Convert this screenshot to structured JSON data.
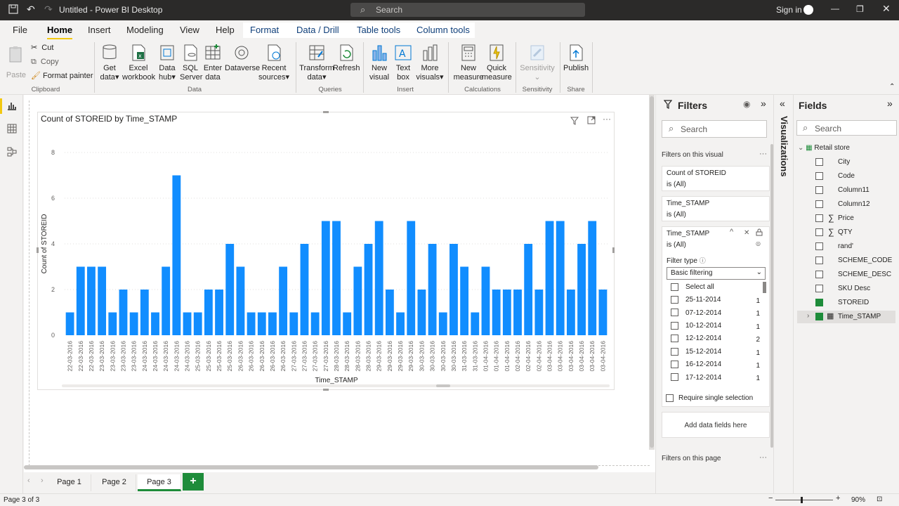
{
  "titlebar": {
    "title": "Untitled - Power BI Desktop",
    "search": "Search",
    "signin": "Sign in"
  },
  "menu": {
    "file": "File",
    "home": "Home",
    "insert": "Insert",
    "modeling": "Modeling",
    "view": "View",
    "help": "Help",
    "format": "Format",
    "data_drill": "Data / Drill",
    "table_tools": "Table tools",
    "column_tools": "Column tools"
  },
  "ribbon": {
    "paste": "Paste",
    "cut": "Cut",
    "copy": "Copy",
    "format_painter": "Format painter",
    "clipboard": "Clipboard",
    "get_data": [
      "Get",
      "data"
    ],
    "excel": [
      "Excel",
      "workbook"
    ],
    "datahub": [
      "Data",
      "hub"
    ],
    "sql": [
      "SQL",
      "Server"
    ],
    "enter": [
      "Enter",
      "data"
    ],
    "dataverse": "Dataverse",
    "recent": [
      "Recent",
      "sources"
    ],
    "data_group": "Data",
    "transform": [
      "Transform",
      "data"
    ],
    "refresh": "Refresh",
    "queries": "Queries",
    "new_visual": [
      "New",
      "visual"
    ],
    "text_box": [
      "Text",
      "box"
    ],
    "more_visuals": [
      "More",
      "visuals"
    ],
    "insert": "Insert",
    "new_measure": [
      "New",
      "measure"
    ],
    "quick_measure": [
      "Quick",
      "measure"
    ],
    "calculations": "Calculations",
    "sensitivity_btn": "Sensitivity",
    "sensitivity": "Sensitivity",
    "publish": "Publish",
    "share": "Share"
  },
  "visual": {
    "title": "Count of STOREID by Time_STAMP"
  },
  "chart_data": {
    "type": "bar",
    "title": "Count of STOREID by Time_STAMP",
    "xlabel": "Time_STAMP",
    "ylabel": "Count of STOREID",
    "ylim": [
      0,
      8
    ],
    "yticks": [
      0,
      2,
      4,
      6,
      8
    ],
    "color": "#118dff",
    "categories": [
      "22-03-2016",
      "22-03-2016",
      "22-03-2016",
      "23-03-2016",
      "23-03-2016",
      "23-03-2016",
      "23-03-2016",
      "24-03-2016",
      "24-03-2016",
      "24-03-2016",
      "24-03-2016",
      "24-03-2016",
      "25-03-2016",
      "25-03-2016",
      "25-03-2016",
      "25-03-2016",
      "26-03-2016",
      "26-03-2016",
      "26-03-2016",
      "26-03-2016",
      "26-03-2016",
      "27-03-2016",
      "27-03-2016",
      "27-03-2016",
      "27-03-2016",
      "28-03-2016",
      "28-03-2016",
      "28-03-2016",
      "28-03-2016",
      "29-03-2016",
      "29-03-2016",
      "29-03-2016",
      "29-03-2016",
      "30-03-2016",
      "30-03-2016",
      "30-03-2016",
      "30-03-2016",
      "31-03-2016",
      "31-03-2016",
      "01-04-2016",
      "01-04-2016",
      "01-04-2016",
      "02-04-2016",
      "02-04-2016",
      "02-04-2016",
      "03-04-2016",
      "03-04-2016",
      "03-04-2016",
      "03-04-2016",
      "03-04-2016",
      "03-04-2016",
      "03-04-2016",
      "03-04-2016",
      "03-04-2016",
      "03-04-2016",
      "03-04-2016",
      "03-04-2016",
      "03-04-2016",
      "03-04-2016",
      "03-04-2016",
      "03-04-2016",
      "03-04-2016",
      "03-04-2016",
      "03-04-2016",
      "03-04-2016",
      "03-04-2016",
      "03-04-2016",
      "03-04-2016"
    ],
    "values": [
      1,
      3,
      3,
      3,
      1,
      2,
      1,
      2,
      1,
      3,
      7,
      1,
      1,
      2,
      2,
      4,
      3,
      1,
      1,
      1,
      3,
      1,
      4,
      1,
      5,
      5,
      1,
      3,
      4,
      5,
      2,
      1,
      5,
      2,
      4,
      1,
      4,
      3,
      1,
      3,
      2,
      2,
      2,
      4,
      2,
      5,
      5,
      2,
      4,
      5,
      2
    ]
  },
  "filters": {
    "title": "Filters",
    "search": "Search",
    "on_visual": "Filters on this visual",
    "card1": {
      "name": "Count of STOREID",
      "state": "is (All)"
    },
    "card2": {
      "name": "Time_STAMP",
      "state": "is (All)"
    },
    "card3": {
      "name": "Time_STAMP",
      "state": "is (All)",
      "filter_type_label": "Filter type",
      "filter_type": "Basic filtering",
      "select_all": "Select all",
      "items": [
        {
          "label": "25-11-2014",
          "count": "1"
        },
        {
          "label": "07-12-2014",
          "count": "1"
        },
        {
          "label": "10-12-2014",
          "count": "1"
        },
        {
          "label": "12-12-2014",
          "count": "2"
        },
        {
          "label": "15-12-2014",
          "count": "1"
        },
        {
          "label": "16-12-2014",
          "count": "1"
        },
        {
          "label": "17-12-2014",
          "count": "1"
        }
      ],
      "require_single": "Require single selection"
    },
    "add_fields": "Add data fields here",
    "on_page": "Filters on this page"
  },
  "viz_label": "Visualizations",
  "fields": {
    "title": "Fields",
    "search": "Search",
    "table": "Retail store",
    "items": [
      {
        "label": "City",
        "checked": false,
        "sigma": false
      },
      {
        "label": "Code",
        "checked": false,
        "sigma": false
      },
      {
        "label": "Column11",
        "checked": false,
        "sigma": false
      },
      {
        "label": "Column12",
        "checked": false,
        "sigma": false
      },
      {
        "label": "Price",
        "checked": false,
        "sigma": true
      },
      {
        "label": "QTY",
        "checked": false,
        "sigma": true
      },
      {
        "label": "rand'",
        "checked": false,
        "sigma": false
      },
      {
        "label": "SCHEME_CODE",
        "checked": false,
        "sigma": false
      },
      {
        "label": "SCHEME_DESC",
        "checked": false,
        "sigma": false
      },
      {
        "label": "SKU Desc",
        "checked": false,
        "sigma": false
      },
      {
        "label": "STOREID",
        "checked": true,
        "sigma": false
      },
      {
        "label": "Time_STAMP",
        "checked": true,
        "sigma": false
      }
    ]
  },
  "pages": {
    "tabs": [
      "Page 1",
      "Page 2",
      "Page 3"
    ],
    "active": "Page 3",
    "add": "+"
  },
  "status": {
    "page": "Page 3 of 3",
    "zoom": "90%"
  }
}
